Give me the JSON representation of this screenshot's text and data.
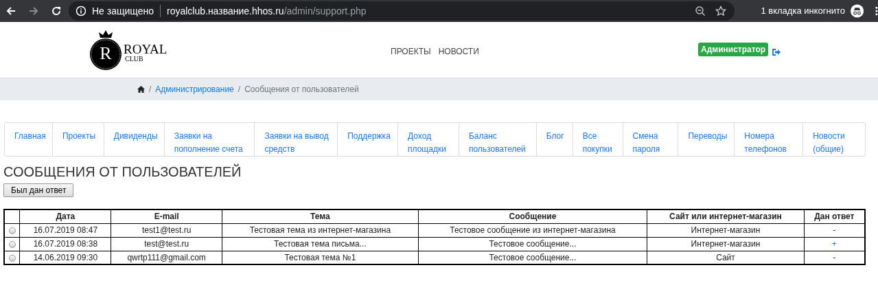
{
  "browser": {
    "security": "Не защищено",
    "url_host": "royalclub.название.hhos.ru",
    "url_path": "/admin/support.php",
    "incognito": "1 вкладка инкогнито"
  },
  "logo": {
    "letter": "R",
    "name": "ROYAL",
    "sub": "CLUB"
  },
  "nav": [
    "ПРОЕКТЫ",
    "НОВОСТИ"
  ],
  "role_badge": "Администратор",
  "breadcrumb_separator": "/",
  "breadcrumb": [
    {
      "kind": "link",
      "label": "Администрирование"
    },
    {
      "kind": "current",
      "label": "Сообщения от пользователей"
    }
  ],
  "menu": [
    "Главная",
    "Проекты",
    "Дивиденды",
    "Заявки на пополнение счета",
    "Заявки на вывод средств",
    "Поддержка",
    "Доход площадки",
    "Баланс пользователей",
    "Блог",
    "Все покупки",
    "Смена пароля",
    "Переводы",
    "Номера телефонов",
    "Новости (общие)"
  ],
  "page_title": "СООБЩЕНИЯ ОТ ПОЛЬЗОВАТЕЛЕЙ",
  "filter_button": "Был дан ответ",
  "table": {
    "columns": [
      "Дата",
      "E-mail",
      "Тема",
      "Сообщение",
      "Сайт или интернет-магазин",
      "Дан ответ"
    ],
    "rows": [
      {
        "selected": false,
        "cells": [
          "16.07.2019 08:47",
          "test1@test.ru",
          "Тестовая тема из интернет-магазина",
          "Тестовое сообщение из интернет-магазина",
          "Интернет-магазин",
          "-"
        ],
        "answered": false
      },
      {
        "selected": false,
        "cells": [
          "16.07.2019 08:38",
          "test@test.ru",
          "Тестовая тема письма...",
          "Тестовое сообщение...",
          "Интернет-магазин",
          "+"
        ],
        "answered": true
      },
      {
        "selected": false,
        "cells": [
          "14.06.2019 09:30",
          "qwrtp111@gmail.com",
          "Тестовая тема №1",
          "Тестовое сообщение...",
          "Сайт",
          "-"
        ],
        "answered": false
      }
    ]
  }
}
